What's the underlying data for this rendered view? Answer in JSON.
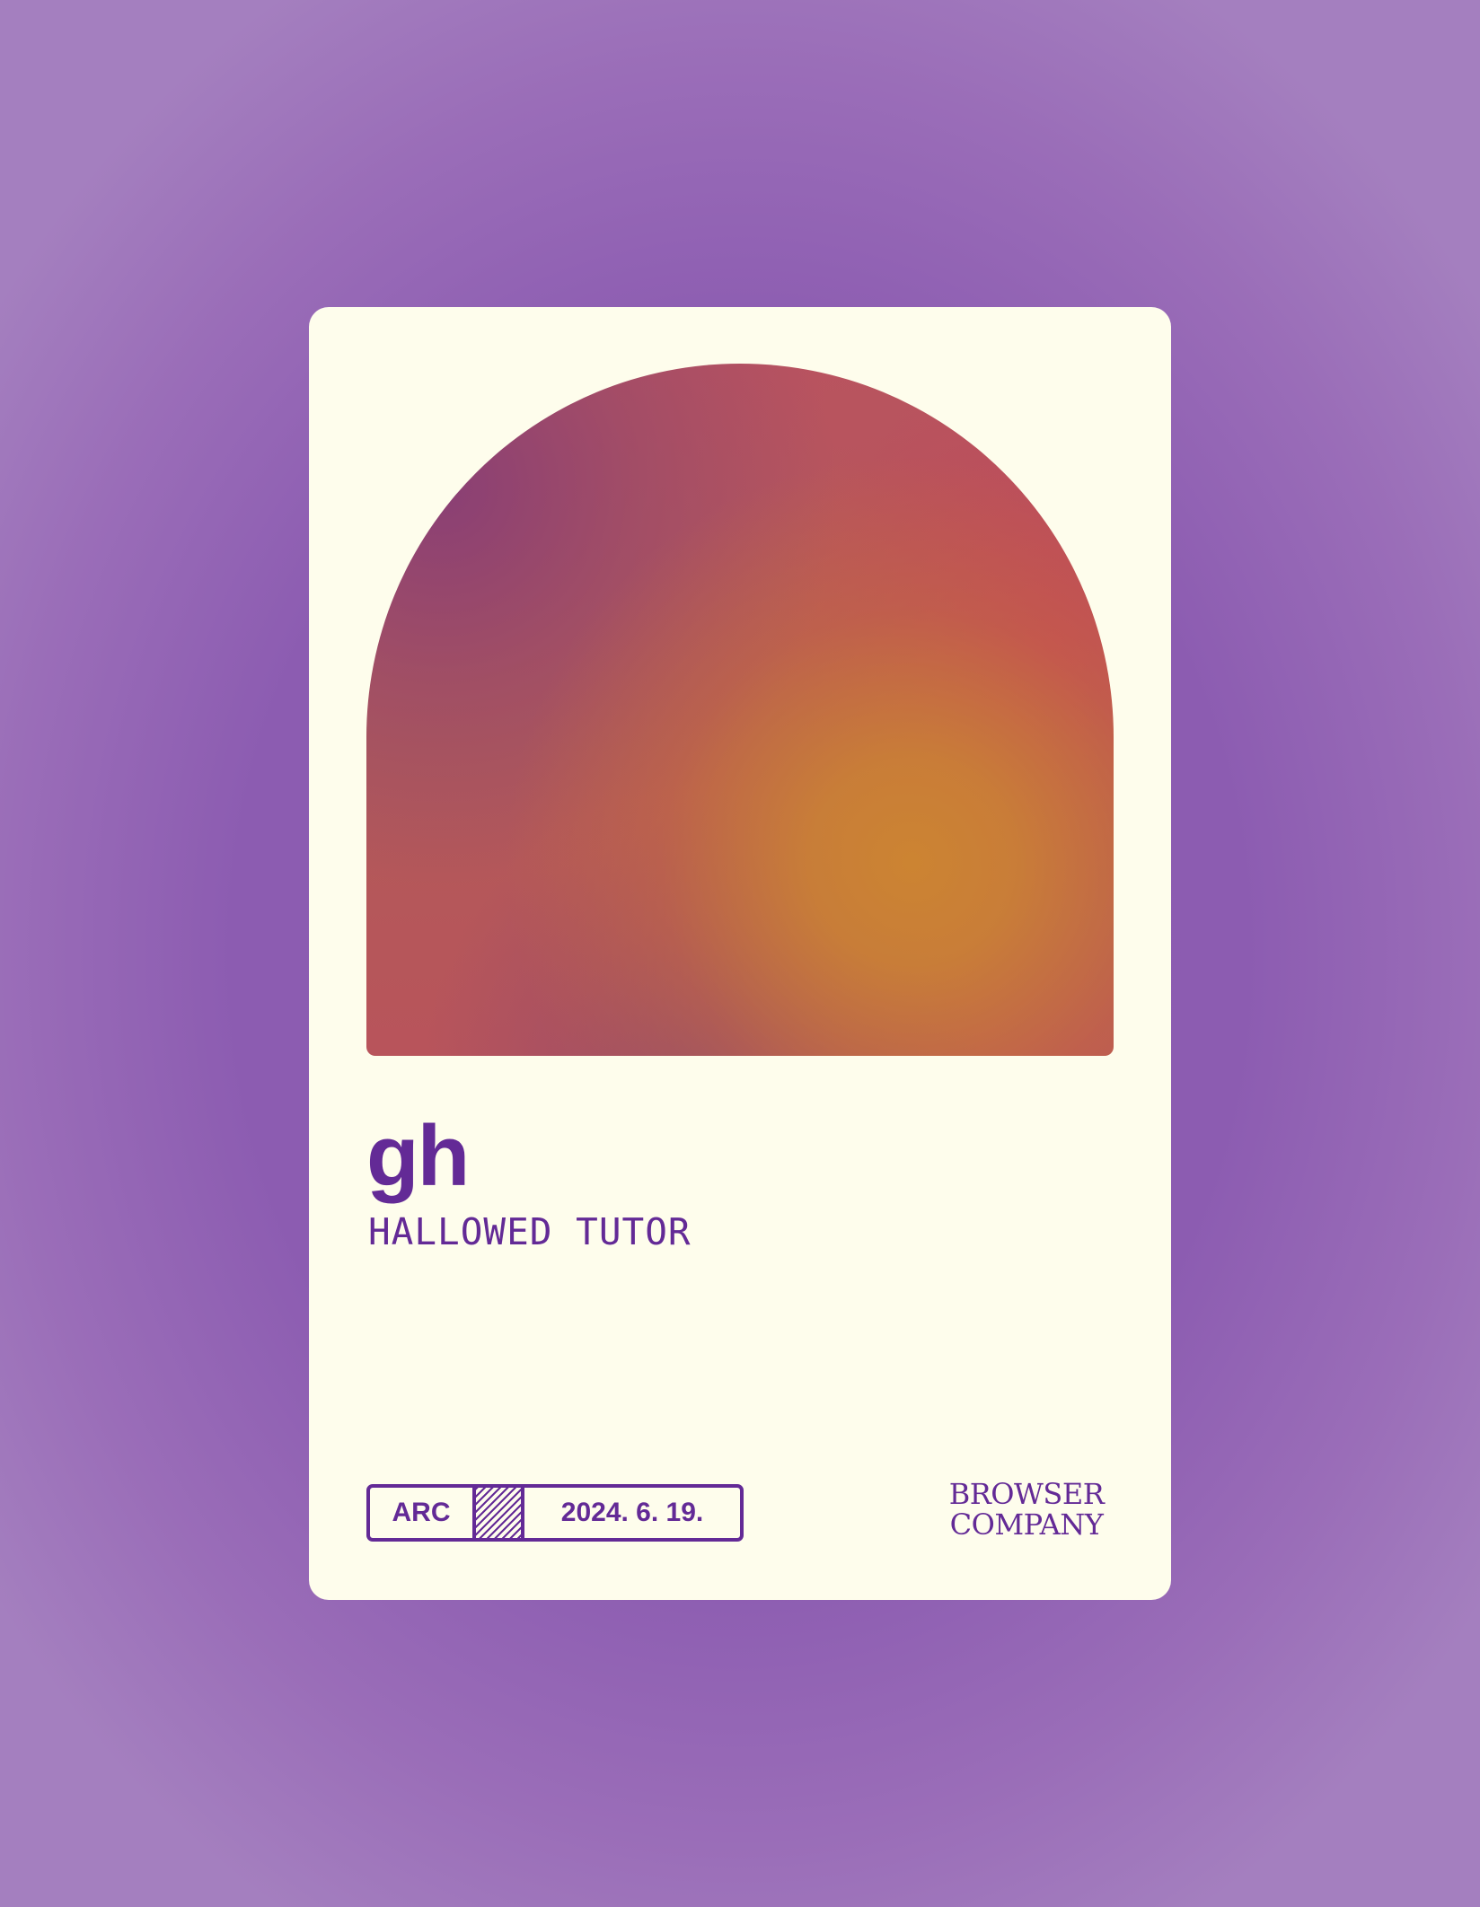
{
  "card": {
    "title": "gh",
    "subtitle": "HALLOWED TUTOR",
    "badge": {
      "label": "ARC",
      "date": "2024. 6. 19."
    },
    "logo": {
      "line1": "BROWSER",
      "line2": "COMPANY"
    }
  },
  "colors": {
    "background": "#8c5cb1",
    "card": "#fefdec",
    "text": "#632a96",
    "art_orange": "#cc8432",
    "art_red": "#b9535f",
    "art_plum": "#873e76"
  }
}
